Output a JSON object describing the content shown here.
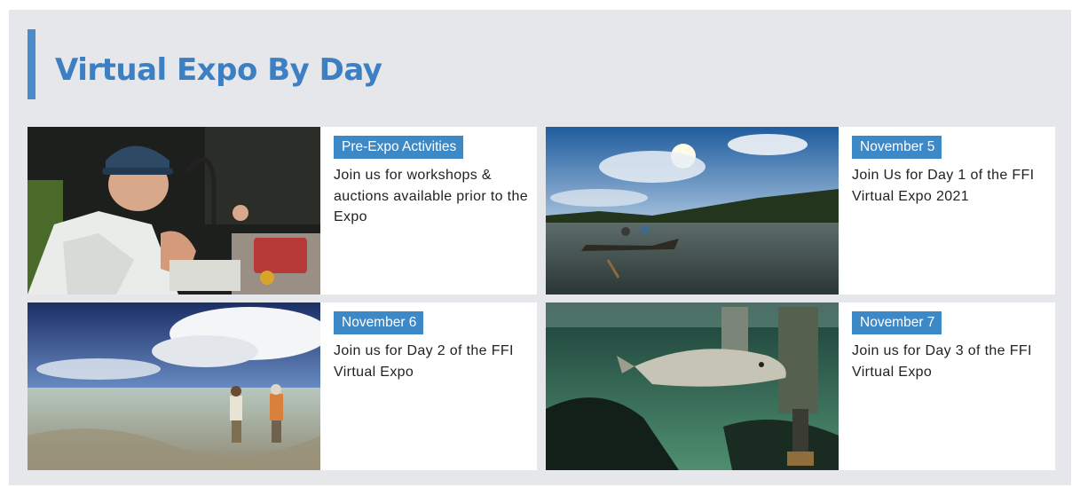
{
  "page": {
    "title": "Virtual Expo By Day",
    "accent_color": "#4a8bc9",
    "tag_color": "#3d88c6"
  },
  "cards": [
    {
      "tag": "Pre-Expo Activities",
      "description": "Join us for workshops & auctions available prior to the Expo",
      "image": "fly-tying-photo"
    },
    {
      "tag": "November 5",
      "description": "Join Us for Day 1 of the FFI Virtual Expo 2021",
      "image": "drift-boat-river-photo"
    },
    {
      "tag": "November 6",
      "description": "Join us for Day 2 of the FFI Virtual Expo",
      "image": "saltwater-flats-wading-photo"
    },
    {
      "tag": "November 7",
      "description": "Join us for Day 3 of the FFI Virtual Expo",
      "image": "underwater-fish-release-photo"
    }
  ]
}
